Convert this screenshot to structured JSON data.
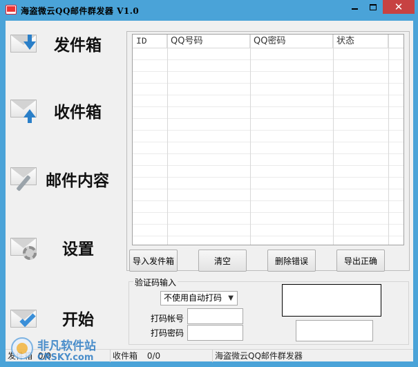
{
  "window": {
    "title": "海盗微云QQ邮件群发器 V1.0",
    "controls": {
      "minimize": "minimize-icon",
      "maximize": "maximize-icon",
      "close": "✕"
    }
  },
  "nav": {
    "items": [
      {
        "label": "发件箱",
        "icon": "envelope-download-icon"
      },
      {
        "label": "收件箱",
        "icon": "envelope-upload-icon"
      },
      {
        "label": "邮件内容",
        "icon": "envelope-pen-icon"
      },
      {
        "label": "设置",
        "icon": "envelope-gear-icon"
      },
      {
        "label": "开始",
        "icon": "envelope-check-icon"
      }
    ]
  },
  "grid": {
    "columns": [
      "ID",
      "QQ号码",
      "QQ密码",
      "状态"
    ],
    "rows": []
  },
  "actions": {
    "import_label": "导入发件箱",
    "clear_label": "清空",
    "delete_errors_label": "删除错误",
    "export_correct_label": "导出正确"
  },
  "captcha": {
    "group_label": "验证码输入",
    "mode_selected": "不使用自动打码",
    "account_label": "打码帐号",
    "password_label": "打码密码",
    "account_value": "",
    "password_value": ""
  },
  "status": {
    "outbox_label": "发件箱",
    "outbox_count": "0/0",
    "inbox_label": "收件箱",
    "inbox_count": "0/0",
    "app_name": "海盗微云QQ邮件群发器"
  },
  "watermark": {
    "text": "非凡软件站",
    "sub": "CRSKY.com"
  },
  "colors": {
    "titlebar": "#4aa3d8",
    "close": "#c74242",
    "arrow_blue": "#2a7fc8"
  }
}
